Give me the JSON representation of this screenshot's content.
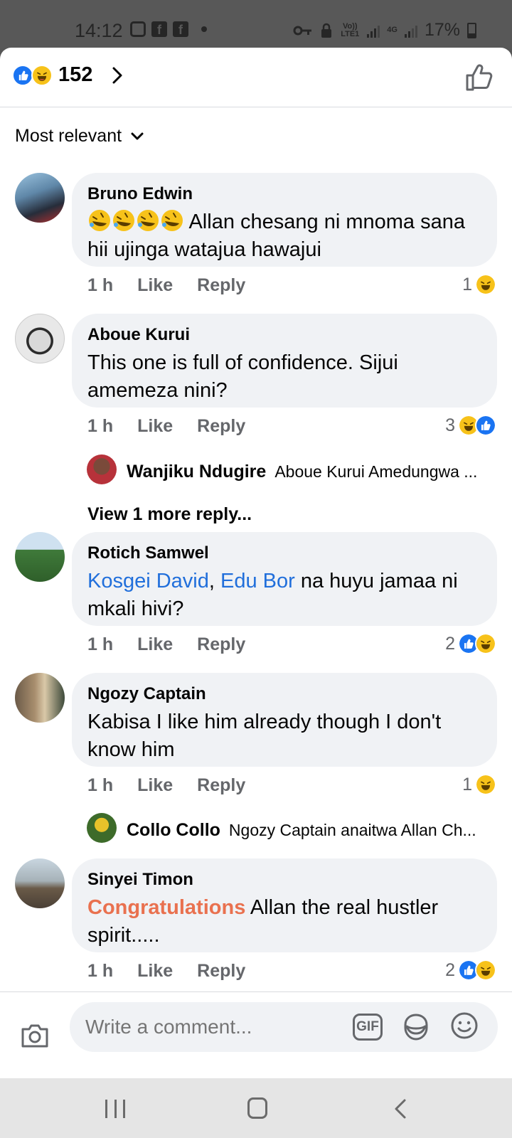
{
  "status_bar": {
    "time": "14:12",
    "battery": "17%",
    "network_labels": [
      "Vo)) LTE1",
      "4G"
    ],
    "icons": [
      "instagram-icon",
      "facebook-icon",
      "facebook-icon",
      "dot-icon",
      "key-icon",
      "lock-icon",
      "signal-icon",
      "battery-icon"
    ]
  },
  "reactions_header": {
    "count": "152",
    "icons": [
      "like-reaction-icon",
      "haha-reaction-icon"
    ]
  },
  "sort": {
    "label": "Most relevant"
  },
  "comments": [
    {
      "author": "Bruno Edwin",
      "emoji_prefix": [
        "rolling-laughing-emoji",
        "rolling-laughing-emoji",
        "rolling-laughing-emoji",
        "rolling-laughing-emoji"
      ],
      "text": "Allan chesang ni mnoma sana hii ujinga watajua hawajui",
      "time": "1 h",
      "like_label": "Like",
      "reply_label": "Reply",
      "reaction_count": "1",
      "reactions": [
        "haha"
      ]
    },
    {
      "author": "Aboue Kurui",
      "text": "This one is full of confidence. Sijui amemeza nini?",
      "time": "1 h",
      "like_label": "Like",
      "reply_label": "Reply",
      "reaction_count": "3",
      "reactions": [
        "haha",
        "like"
      ],
      "reply_preview": {
        "author": "Wanjiku Ndugire",
        "text": "Aboue Kurui Amedungwa ..."
      },
      "view_more": "View 1 more reply..."
    },
    {
      "author": "Rotich Samwel",
      "mentions": [
        "Kosgei David",
        "Edu Bor"
      ],
      "separator": ",",
      "text": "na huyu jamaa ni mkali hivi?",
      "time": "1 h",
      "like_label": "Like",
      "reply_label": "Reply",
      "reaction_count": "2",
      "reactions": [
        "like",
        "haha"
      ]
    },
    {
      "author": "Ngozy Captain",
      "text": "Kabisa I like him already though I don't know him",
      "time": "1 h",
      "like_label": "Like",
      "reply_label": "Reply",
      "reaction_count": "1",
      "reactions": [
        "haha"
      ],
      "reply_preview": {
        "author": "Collo Collo",
        "text": "Ngozy Captain  anaitwa Allan Ch..."
      }
    },
    {
      "author": "Sinyei Timon",
      "highlight": "Congratulations",
      "text": "Allan the real hustler spirit.....",
      "time": "1 h",
      "like_label": "Like",
      "reply_label": "Reply",
      "reaction_count": "2",
      "reactions": [
        "like",
        "haha"
      ]
    }
  ],
  "composer": {
    "placeholder": "Write a comment...",
    "gif_label": "GIF"
  },
  "colors": {
    "accent_blue": "#1a74f2",
    "mention_blue": "#216fdb",
    "haha_yellow": "#f7c21a",
    "bubble_bg": "#f0f2f5",
    "meta_gray": "#65676b",
    "congrats_orange": "#e9714f"
  }
}
